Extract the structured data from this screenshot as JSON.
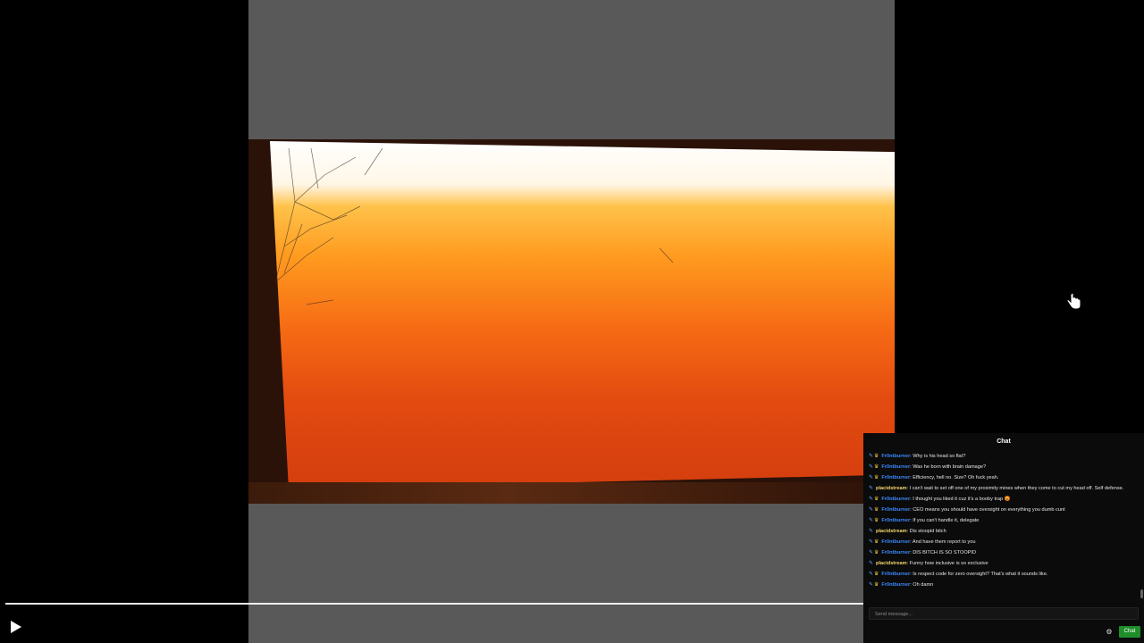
{
  "player": {
    "play_icon": "play-icon",
    "colors": {
      "background": "#000000",
      "video_bg": "#595959",
      "scrubber": "#ffffff"
    }
  },
  "chat": {
    "title": "Chat",
    "messages": [
      {
        "user": "Fr0ntburner",
        "user_color": "blue",
        "text": ": Why is his head so flat?"
      },
      {
        "user": "Fr0ntburner",
        "user_color": "blue",
        "text": ": Was he born with brain damage?"
      },
      {
        "user": "Fr0ntburner",
        "user_color": "blue",
        "text": ": Efficiency, hell no. Size? Oh fuck yeah."
      },
      {
        "user": "placidstream",
        "user_color": "yellow",
        "text": ": I can't wait to set off one of my proximity mines when they come to cut my head off. Self defense."
      },
      {
        "user": "Fr0ntburner",
        "user_color": "blue",
        "text": ": I thought you liked it cuz it's a booby trap",
        "emoji": "😡"
      },
      {
        "user": "Fr0ntburner",
        "user_color": "blue",
        "text": ": CEO means you should have oversight on everything you dumb cunt"
      },
      {
        "user": "Fr0ntburner",
        "user_color": "blue",
        "text": ": If you can't handle it, delegate"
      },
      {
        "user": "placidstream",
        "user_color": "yellow",
        "text": ": Dis stoopid bitch"
      },
      {
        "user": "Fr0ntburner",
        "user_color": "blue",
        "text": ": And have them report to you"
      },
      {
        "user": "Fr0ntburner",
        "user_color": "blue",
        "text": ": DIS BITCH IS SO STOOPID"
      },
      {
        "user": "placidstream",
        "user_color": "yellow",
        "text": ": Funny how inclusive is so exclusive"
      },
      {
        "user": "Fr0ntburner",
        "user_color": "blue",
        "text": ": Is respect code for zero oversight? That's what it sounds like."
      },
      {
        "user": "Fr0ntburner",
        "user_color": "blue",
        "text": ": Oh damn"
      }
    ],
    "input": {
      "placeholder": "Send message..."
    },
    "send_label": "Chat",
    "settings_icon": "gear-icon",
    "colors": {
      "send_button": "#1f8d2a",
      "username_blue": "#3b8bff",
      "username_yellow": "#f5d76e"
    }
  }
}
